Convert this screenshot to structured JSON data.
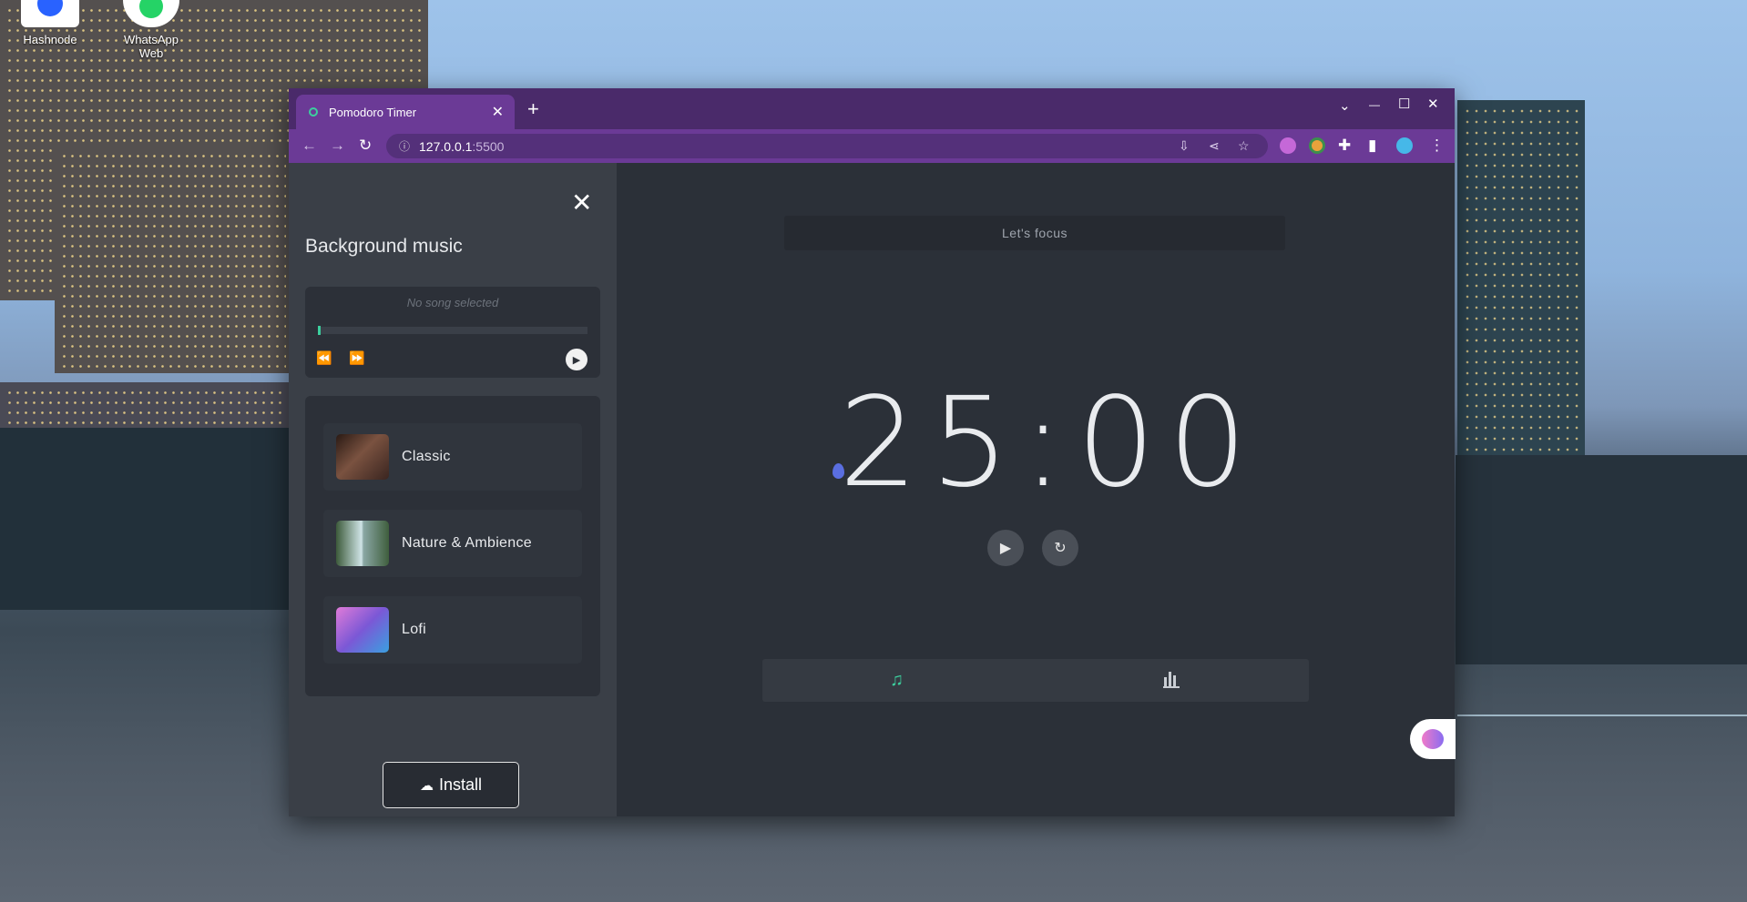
{
  "desktop": {
    "icons": [
      {
        "label": "Hashnode",
        "icon": "hashnode-icon"
      },
      {
        "label": "WhatsApp Web",
        "icon": "whatsapp-icon"
      }
    ]
  },
  "browser": {
    "tab": {
      "title": "Pomodoro Timer",
      "favicon": "pomodoro-favicon-icon",
      "close": "✕"
    },
    "new_tab": "+",
    "window_controls": {
      "dropdown": "⌄",
      "minimize": "—",
      "maximize": "☐",
      "close": "✕"
    },
    "address": {
      "host": "127.0.0.1",
      "port": ":5500"
    },
    "colors": {
      "tabbar": "#4a2a6a",
      "toolbar": "#6b3a96"
    }
  },
  "sidebar": {
    "close": "✕",
    "title": "Background music",
    "player": {
      "song": "No song selected",
      "progress": 0,
      "rewind": "⏪",
      "forward": "⏩",
      "play": "▶"
    },
    "genres": [
      {
        "label": "Classic",
        "thumb": "violin-thumbnail"
      },
      {
        "label": "Nature & Ambience",
        "thumb": "waterfall-thumbnail"
      },
      {
        "label": "Lofi",
        "thumb": "lofi-room-thumbnail"
      }
    ],
    "install_label": "Install"
  },
  "main": {
    "focus_text": "Let's focus",
    "timer": "25:00",
    "play": "▶",
    "reset": "↻",
    "bottom": {
      "music": "♫",
      "stats": "stats-icon"
    },
    "accent": "#3ccf9e"
  }
}
